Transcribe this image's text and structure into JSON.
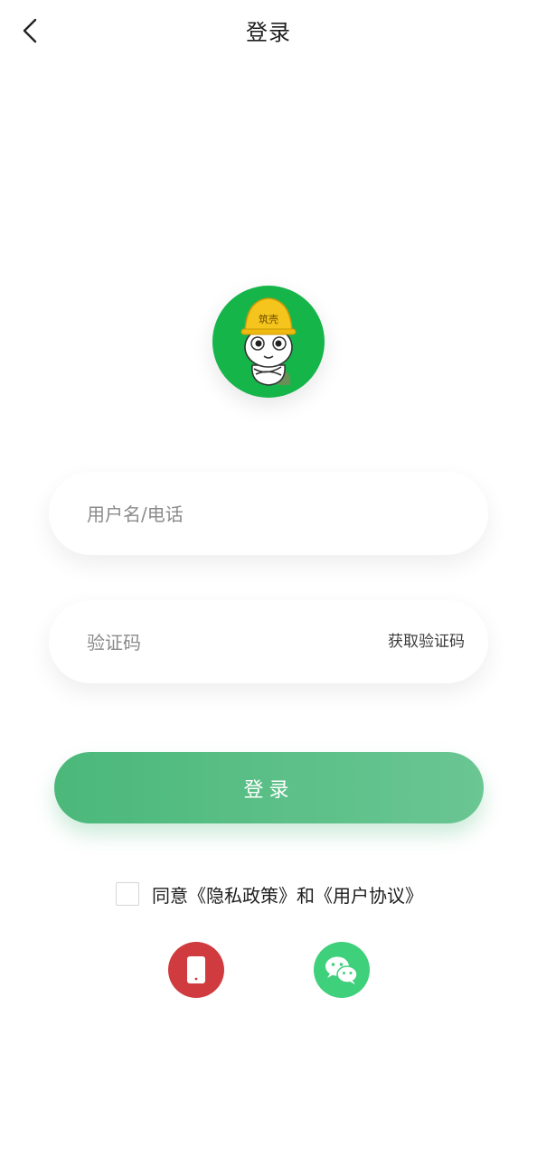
{
  "header": {
    "title": "登录",
    "back_icon": "chevron-left-icon"
  },
  "logo": {
    "helmet_text": "筑壳",
    "bg_color": "#16b54a",
    "helmet_color": "#f5c51d"
  },
  "form": {
    "username_placeholder": "用户名/电话",
    "code_placeholder": "验证码",
    "get_code_label": "获取验证码"
  },
  "login_button": {
    "label": "登录",
    "color": "#4bb87a"
  },
  "agreement": {
    "text": "同意《隐私政策》和《用户协议》",
    "checked": false
  },
  "social": {
    "phone": {
      "icon": "phone-icon",
      "color": "#cf3b3e"
    },
    "wechat": {
      "icon": "wechat-icon",
      "color": "#3fd07c"
    }
  }
}
